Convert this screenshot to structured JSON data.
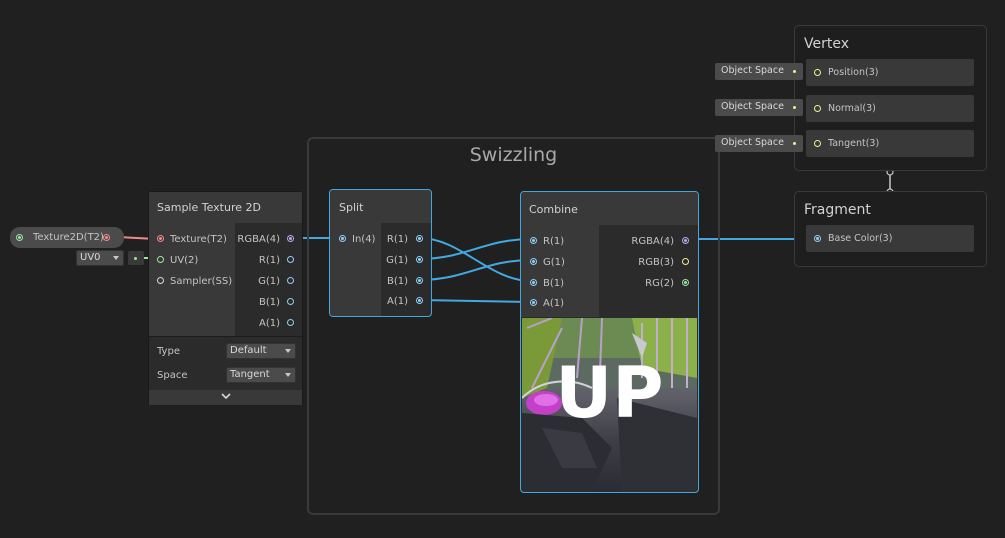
{
  "group": {
    "title": "Swizzling"
  },
  "texture_property": {
    "label": "Texture2D(T2)"
  },
  "uv_dropdown": {
    "value": "UV0"
  },
  "sample_texture": {
    "title": "Sample Texture 2D",
    "inputs": [
      "Texture(T2)",
      "UV(2)",
      "Sampler(SS)"
    ],
    "outputs": [
      "RGBA(4)",
      "R(1)",
      "G(1)",
      "B(1)",
      "A(1)"
    ],
    "type_label": "Type",
    "type_value": "Default",
    "space_label": "Space",
    "space_value": "Tangent"
  },
  "split": {
    "title": "Split",
    "input": "In(4)",
    "outputs": [
      "R(1)",
      "G(1)",
      "B(1)",
      "A(1)"
    ]
  },
  "combine": {
    "title": "Combine",
    "inputs": [
      "R(1)",
      "G(1)",
      "B(1)",
      "A(1)"
    ],
    "outputs": [
      "RGBA(4)",
      "RGB(3)",
      "RG(2)"
    ],
    "preview_text": "UP"
  },
  "vertex": {
    "title": "Vertex",
    "ports": [
      "Position(3)",
      "Normal(3)",
      "Tangent(3)"
    ],
    "space_pills": [
      "Object Space",
      "Object Space",
      "Object Space"
    ]
  },
  "fragment": {
    "title": "Fragment",
    "ports": [
      "Base Color(3)"
    ]
  },
  "colors": {
    "background": "#202020",
    "wire_vector": "#44a8e0",
    "wire_texture": "#f08a8a",
    "selection": "#44a8e0"
  }
}
